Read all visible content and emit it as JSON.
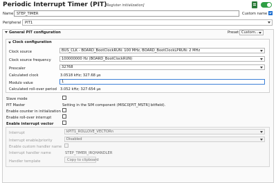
{
  "header": {
    "title": "Periodic Interrupt Timer (PIT)",
    "subtitle": "[Register initialization]"
  },
  "fields": {
    "name_label": "Name",
    "name_value": "STEP_TIMER",
    "custom_name_label": "Custom name",
    "peripheral_label": "Peripheral",
    "peripheral_value": "PIT1"
  },
  "general": {
    "section_label": "General PIT configuration",
    "preset_label": "Preset",
    "preset_value": "Custom..."
  },
  "clock": {
    "section_label": "Clock configuration",
    "rows": [
      {
        "label": "Clock source",
        "value": "BUS_CLK - BOARD_BootClockRUN: 100 MHz, BOARD_BootClockLPRUN: 2 MHz"
      },
      {
        "label": "Clock source frequency",
        "value": "100000000 Hz (BOARD_BootClockRUN)"
      },
      {
        "label": "Prescaler",
        "value": "32768"
      },
      {
        "label": "Calculated clock",
        "value": "3.0518 kHz; 327.68 µs"
      },
      {
        "label": "Modulo value",
        "value": "1"
      },
      {
        "label": "Calculated roll-over period",
        "value": "3.052 kHz; 327.654 µs"
      }
    ]
  },
  "options": {
    "slave_mode": "Slave mode",
    "pit_master": "PIT Master",
    "pit_master_value": "Setting in the SIM component (MISC0[PIT_MSTR] bitfield).",
    "enable_counter": "Enable counter in initialization",
    "enable_rollover": "Enable roll-over interrupt",
    "enable_vector": "Enable interrupt vector"
  },
  "interrupt": {
    "interrupt_label": "Interrupt",
    "interrupt_value": "kPIT1_ROLLOVE_VECTORn",
    "priority_label": "Interrupt enable/priority",
    "priority_value": "Disabled",
    "custom_handler_label": "Enable custom handler name",
    "handler_name_label": "Interrupt handler name",
    "handler_name_value": "STEP_TIMER_IRQHANDLER",
    "template_label": "Handler template",
    "copy_button": "Copy to clipboard"
  }
}
